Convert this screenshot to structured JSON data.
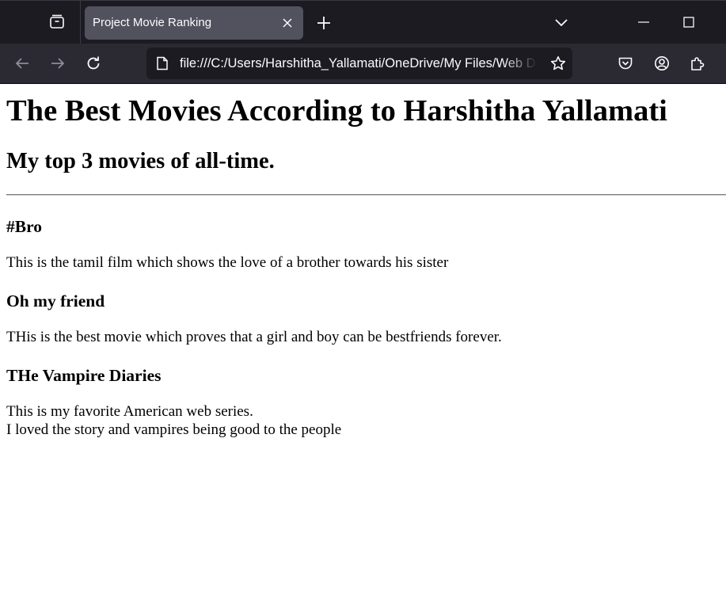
{
  "browser": {
    "tab": {
      "title": "Project Movie Ranking"
    },
    "url": "file:///C:/Users/Harshitha_Yallamati/OneDrive/My Files/Web Development/Movie Ranking/index.html"
  },
  "icons": {
    "firefox_view": "firefox-view-icon",
    "close_tab": "close-icon",
    "new_tab": "plus-icon",
    "list_all_tabs": "chevron-down-icon",
    "minimize": "minimize-icon",
    "maximize": "maximize-icon",
    "back": "back-arrow-icon",
    "forward": "forward-arrow-icon",
    "reload": "reload-icon",
    "page": "page-icon",
    "bookmark": "star-icon",
    "pocket": "pocket-icon",
    "account": "account-icon",
    "extensions": "extensions-icon"
  },
  "colors": {
    "tab_strip_bg": "#1c1b22",
    "toolbar_bg": "#2b2a33",
    "active_tab_bg": "#52525e",
    "icon_color": "#fbfbfe"
  },
  "page": {
    "heading": "The Best Movies According to Harshitha Yallamati",
    "subheading": "My top 3 movies of all-time.",
    "movies": [
      {
        "title": "#Bro",
        "description": [
          "This is the tamil film which shows the love of a brother towards his sister"
        ]
      },
      {
        "title": "Oh my friend",
        "description": [
          "THis is the best movie which proves that a girl and boy can be bestfriends forever."
        ]
      },
      {
        "title": "THe Vampire Diaries",
        "description": [
          "This is my favorite American web series.",
          "I loved the story and vampires being good to the people"
        ]
      }
    ]
  }
}
